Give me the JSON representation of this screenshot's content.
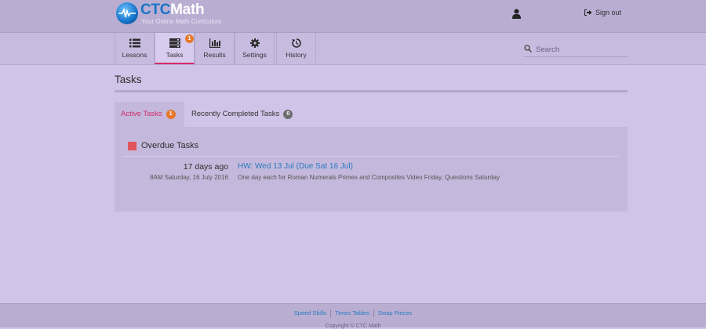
{
  "brand": {
    "name_part1": "CTC",
    "name_part2": "Math",
    "tagline": "Your Online Math Curriculum"
  },
  "header": {
    "user_icon": "user-icon",
    "signout_label": "Sign out",
    "signout_icon": "sign-out-icon"
  },
  "nav": {
    "items": [
      {
        "label": "Lessons",
        "icon": "list-icon"
      },
      {
        "label": "Tasks",
        "icon": "tasks-icon",
        "badge": "1"
      },
      {
        "label": "Results",
        "icon": "bar-chart-icon"
      },
      {
        "label": "Settings",
        "icon": "gear-icon"
      },
      {
        "label": "History",
        "icon": "history-icon"
      }
    ],
    "active_index": 1
  },
  "search": {
    "placeholder": "Search",
    "value": ""
  },
  "page": {
    "title": "Tasks"
  },
  "tabs": [
    {
      "label": "Active Tasks",
      "badge": "1",
      "active": true
    },
    {
      "label": "Recently Completed Tasks",
      "badge": "0",
      "active": false
    }
  ],
  "overdue": {
    "heading": "Overdue Tasks",
    "tasks": [
      {
        "relative_time": "17 days ago",
        "date": "8AM Saturday, 16 July 2016",
        "title": "HW: Wed 13 Jul (Due Sat 16 Jul)",
        "description": "One day each for Roman Numerals Primes and Composites Video Friday, Questions Saturday"
      }
    ]
  },
  "footer": {
    "links": [
      "Speed Skills",
      "Times Tables",
      "Swap Pieces"
    ],
    "copyright": "Copyright © CTC Math"
  },
  "colors": {
    "accent_pink": "#d22c6b",
    "badge_orange": "#e8792b",
    "badge_grey": "#6e6e6e",
    "link_blue": "#2a7ac0",
    "overdue_red": "#e0555b",
    "brand_blue": "#1a74c8",
    "background": "#d0c4e8"
  }
}
